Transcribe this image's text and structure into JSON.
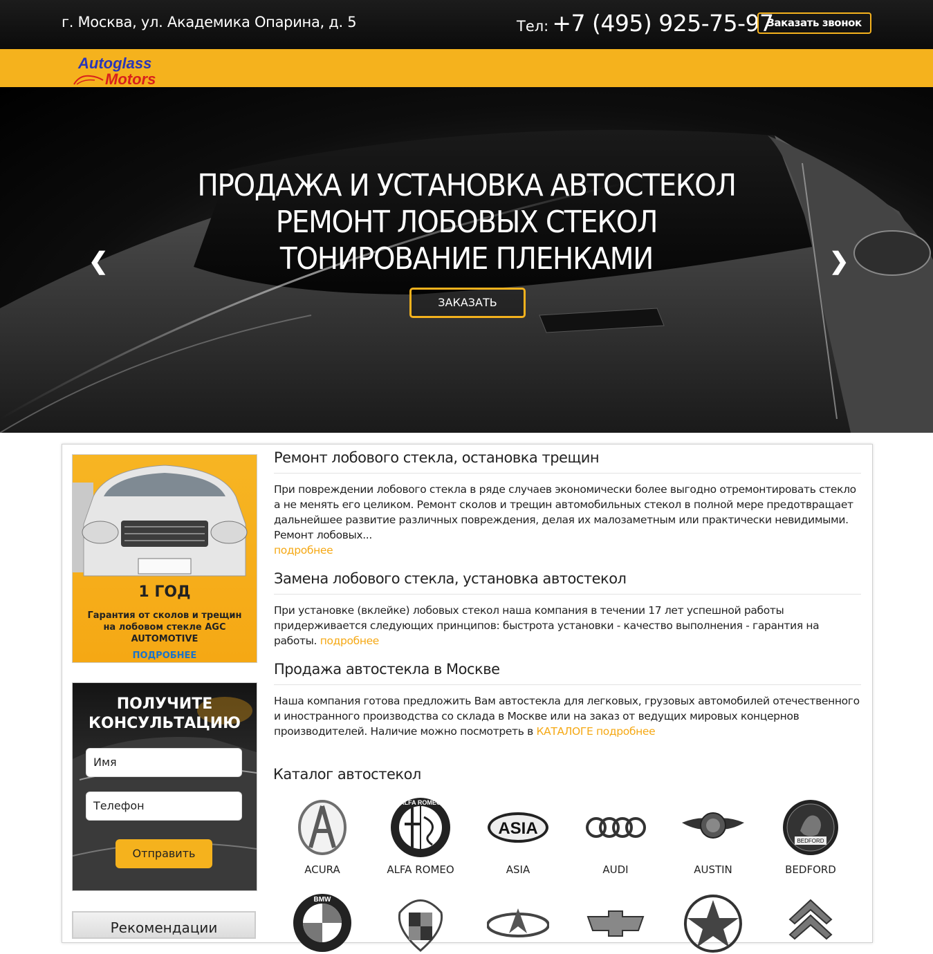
{
  "header": {
    "address": "г. Москва, ул. Академика Опарина, д. 5",
    "phone_label": "Тел:",
    "phone_number": "+7 (495) 925-75-97",
    "callback_button": "Заказать звонок"
  },
  "logo": {
    "line1": "Autoglass",
    "line2": "Motors"
  },
  "hero": {
    "line1": "ПРОДАЖА И УСТАНОВКА АВТОСТЕКОЛ",
    "line2": "РЕМОНТ ЛОБОВЫХ СТЕКОЛ",
    "line3": "ТОНИРОВАНИЕ ПЛЕНКАМИ",
    "order_button": "ЗАКАЗАТЬ",
    "prev_arrow": "❮",
    "next_arrow": "❯"
  },
  "sidebar": {
    "promo": {
      "title": "1 ГОД",
      "description": "Гарантия от сколов и трещин на лобовом стекле AGC AUTOMOTIVE",
      "more": "ПОДРОБНЕЕ"
    },
    "consult": {
      "title_line1": "ПОЛУЧИТЕ",
      "title_line2": "КОНСУЛЬТАЦИЮ",
      "name_placeholder": "Имя",
      "phone_placeholder": "Телефон",
      "submit": "Отправить"
    },
    "recommendations": "Рекомендации"
  },
  "articles": [
    {
      "title": "Ремонт лобового стекла, остановка трещин",
      "text": "При повреждении лобового стекла в ряде случаев экономически более выгодно отремонтировать стекло а не менять его целиком. Ремонт сколов и трещин автомобильных стекол в полной мере предотвращает дальнейшее развитие различных повреждения, делая их малозаметным или практически невидимыми. Ремонт лобовых...",
      "link": "подробнее"
    },
    {
      "title": "Замена лобового стекла, установка автостекол",
      "text": "При установке (вклейке) лобовых стекол наша компания в течении 17 лет успешной работы придерживается следующих принципов: быстрота установки - качество выполнения - гарантия на работы.",
      "link": "подробнее"
    },
    {
      "title": "Продажа автостекла в Москве",
      "text": "Наша компания готова предложить Вам автостекла для легковых, грузовых автомобилей отечественного и иностранного производства со склада в Москве или на заказ от ведущих мировых концернов производителей. Наличие можно посмотреть в",
      "link": "КАТАЛОГЕ подробнее"
    }
  ],
  "catalog": {
    "title": "Каталог автостекол",
    "brands": [
      "ACURA",
      "ALFA ROMEO",
      "ASIA",
      "AUDI",
      "AUSTIN",
      "BEDFORD"
    ],
    "logo_lettering": {
      "alfa_romeo": "ALFA ROMEO",
      "asia": "ASIA",
      "bedford": "BEDFORD",
      "bmw": "BMW"
    }
  },
  "colors": {
    "accent": "#f5b21d",
    "topbar": "#111111",
    "link": "#f5a814",
    "promo_link": "#1a73c9"
  }
}
